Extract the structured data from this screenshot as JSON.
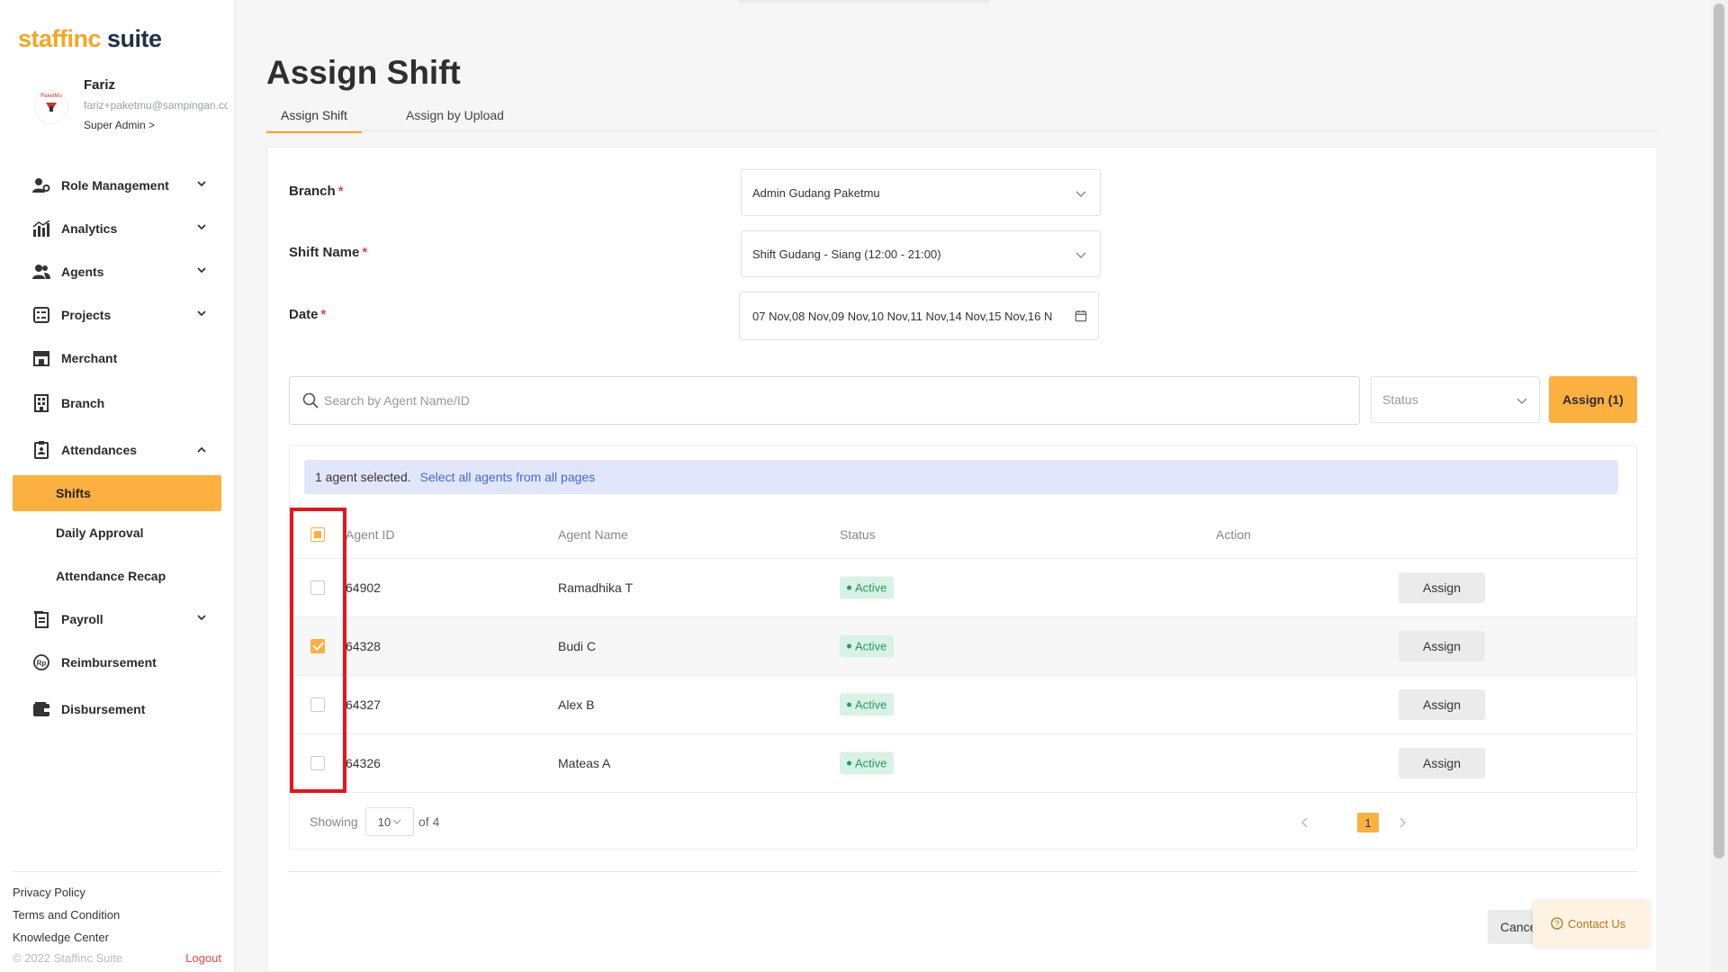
{
  "brand": {
    "logo_part1": "staff",
    "logo_part2": "inc",
    "logo_part3": " suite",
    "accent": "#fbb040"
  },
  "user": {
    "name": "Fariz",
    "email": "fariz+paketmu@sampingan.co",
    "role": "Super Admin >",
    "avatar_text": "PaketMu"
  },
  "sidebar": {
    "items": [
      {
        "label": "Role Management",
        "icon": "role-icon"
      },
      {
        "label": "Analytics",
        "icon": "analytics-icon"
      },
      {
        "label": "Agents",
        "icon": "agents-icon"
      },
      {
        "label": "Projects",
        "icon": "projects-icon"
      },
      {
        "label": "Merchant",
        "icon": "merchant-icon"
      },
      {
        "label": "Branch",
        "icon": "branch-icon"
      },
      {
        "label": "Attendances",
        "icon": "attendance-icon"
      },
      {
        "label": "Payroll",
        "icon": "payroll-icon"
      },
      {
        "label": "Reimbursement",
        "icon": "reimbursement-icon"
      },
      {
        "label": "Disbursement",
        "icon": "disbursement-icon"
      }
    ],
    "attendance_sub": [
      "Shifts",
      "Daily Approval",
      "Attendance Recap"
    ],
    "footer_links": [
      "Privacy Policy",
      "Terms and Condition",
      "Knowledge Center"
    ],
    "copyright": "© 2022 Staffinc Suite",
    "logout": "Logout"
  },
  "page": {
    "title": "Assign Shift",
    "tabs": [
      "Assign Shift",
      "Assign by Upload"
    ]
  },
  "form": {
    "branch_label": "Branch",
    "branch_value": "Admin Gudang Paketmu",
    "shift_label": "Shift Name",
    "shift_value": "Shift Gudang - Siang (12:00 - 21:00)",
    "date_label": "Date",
    "date_value": "07 Nov,08 Nov,09 Nov,10 Nov,11 Nov,14 Nov,15 Nov,16 N",
    "required_mark": "*"
  },
  "filter": {
    "search_placeholder": "Search by Agent Name/ID",
    "status_placeholder": "Status",
    "assign_button": "Assign (1)"
  },
  "selection": {
    "text": "1 agent selected.",
    "link": "Select all agents from all pages"
  },
  "table": {
    "headers": [
      "Agent ID",
      "Agent Name",
      "Status",
      "Action"
    ],
    "rows": [
      {
        "id": "64902",
        "name": "Ramadhika T",
        "status": "Active",
        "action": "Assign",
        "checked": false
      },
      {
        "id": "64328",
        "name": "Budi C",
        "status": "Active",
        "action": "Assign",
        "checked": true
      },
      {
        "id": "64327",
        "name": "Alex B",
        "status": "Active",
        "action": "Assign",
        "checked": false
      },
      {
        "id": "64326",
        "name": "Mateas A",
        "status": "Active",
        "action": "Assign",
        "checked": false
      }
    ]
  },
  "pagination": {
    "showing": "Showing",
    "per_page": "10",
    "of": "of 4",
    "current_page": "1"
  },
  "footer": {
    "cancel": "Cancel",
    "contact": "Contact Us"
  }
}
